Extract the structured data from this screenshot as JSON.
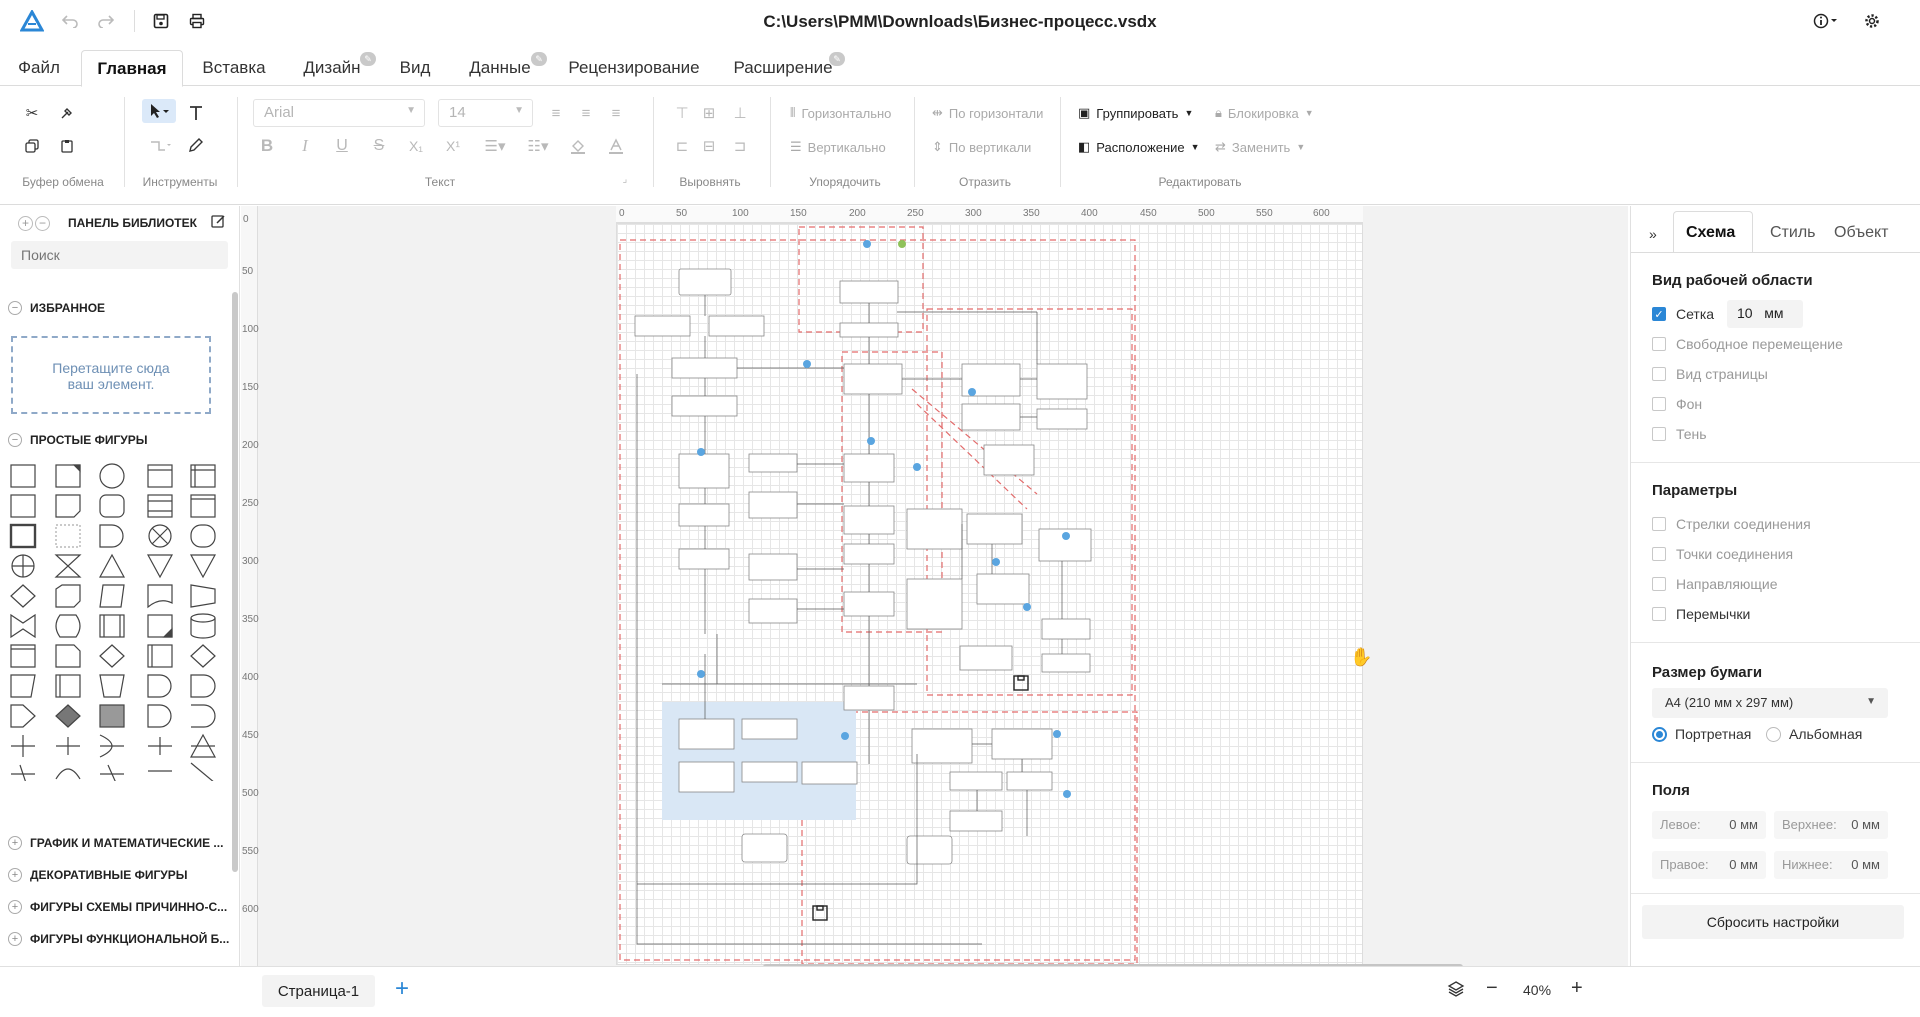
{
  "window": {
    "title": "C:\\Users\\PMM\\Downloads\\Бизнес-процесс.vsdx"
  },
  "menu": {
    "tabs": [
      {
        "label": "Файл"
      },
      {
        "label": "Главная"
      },
      {
        "label": "Вставка"
      },
      {
        "label": "Дизайн"
      },
      {
        "label": "Вид"
      },
      {
        "label": "Данные"
      },
      {
        "label": "Рецензирование"
      },
      {
        "label": "Расширение"
      }
    ],
    "active": "Главная"
  },
  "ribbon": {
    "groups": {
      "clipboard": "Буфер обмена",
      "tools": "Инструменты",
      "text": "Текст",
      "align": "Выровнять",
      "order": "Упорядочить",
      "reflect": "Отразить",
      "edit": "Редактировать"
    },
    "font_name": "Arial",
    "font_size": "14",
    "order_horizontal": "Горизонтально",
    "order_vertical": "Вертикально",
    "reflect_horizontal": "По горизонтали",
    "reflect_vertical": "По вертикали",
    "group": "Группировать",
    "arrange": "Расположение",
    "lock": "Блокировка",
    "replace": "Заменить"
  },
  "library": {
    "title": "ПАНЕЛЬ БИБЛИОТЕК",
    "search_placeholder": "Поиск",
    "favorites": "ИЗБРАННОЕ",
    "dropzone_line1": "Перетащите сюда",
    "dropzone_line2": "ваш элемент.",
    "simple_shapes": "ПРОСТЫЕ ФИГУРЫ",
    "sections": [
      "ГРАФИК И МАТЕМАТИЧЕСКИЕ ...",
      "ДЕКОРАТИВНЫЕ ФИГУРЫ",
      "ФИГУРЫ СХЕМЫ ПРИЧИННО-С...",
      "ФИГУРЫ ФУНКЦИОНАЛЬНОЙ Б..."
    ]
  },
  "ruler": {
    "h": [
      "0",
      "50",
      "100",
      "150",
      "200",
      "250",
      "300",
      "350",
      "400",
      "450",
      "500",
      "550",
      "600"
    ],
    "v": [
      "0",
      "50",
      "100",
      "150",
      "200",
      "250",
      "300",
      "350",
      "400",
      "450",
      "500",
      "550",
      "600"
    ]
  },
  "rightpanel": {
    "tabs": [
      "Схема",
      "Стиль",
      "Объект"
    ],
    "workspace_title": "Вид рабочей области",
    "grid_label": "Сетка",
    "grid_value": "10",
    "grid_unit": "мм",
    "free_move": "Свободное перемещение",
    "page_view": "Вид страницы",
    "background": "Фон",
    "shadow": "Тень",
    "params_title": "Параметры",
    "conn_arrows": "Стрелки соединения",
    "conn_points": "Точки соединения",
    "guides": "Направляющие",
    "jumpers": "Перемычки",
    "paper_title": "Размер бумаги",
    "paper_value": "А4 (210 мм х 297 мм)",
    "portrait": "Портретная",
    "landscape": "Альбомная",
    "margins_title": "Поля",
    "left": "Левое:",
    "top": "Верхнее:",
    "right": "Правое:",
    "bottom": "Нижнее:",
    "margin_value": "0 мм",
    "reset": "Сбросить настройки"
  },
  "bottom": {
    "page_tab": "Страница-1",
    "zoom": "40%"
  }
}
